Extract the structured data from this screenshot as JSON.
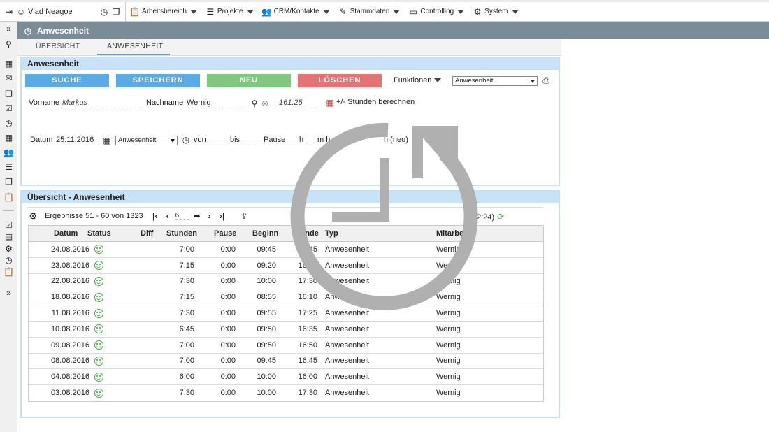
{
  "topbar": {
    "user": "Vlad Neagoe",
    "menus": [
      {
        "label": "Arbeitsbereich",
        "icon": "clipboard-icon"
      },
      {
        "label": "Projekte",
        "icon": "chart-icon"
      },
      {
        "label": "CRM/Kontakte",
        "icon": "contacts-icon"
      },
      {
        "label": "Stammdaten",
        "icon": "pen-icon"
      },
      {
        "label": "Controlling",
        "icon": "presentation-icon"
      },
      {
        "label": "System",
        "icon": "gear-icon"
      }
    ]
  },
  "header": {
    "title": "Anwesenheit"
  },
  "tabs": [
    {
      "label": "ÜBERSICHT"
    },
    {
      "label": "ANWESENHEIT"
    }
  ],
  "form_panel": {
    "title": "Anwesenheit",
    "buttons": {
      "search": "SUCHE",
      "save": "SPEICHERN",
      "new": "NEU",
      "delete": "LÖSCHEN"
    },
    "functions_label": "Funktionen",
    "type_select": "Anwesenheit",
    "vorname_label": "Vorname",
    "vorname_value": "Markus",
    "nachname_label": "Nachname",
    "nachname_value": "Wernig",
    "hours_value": "161:25",
    "calc_label": "+/- Stunden berechnen",
    "datum_label": "Datum",
    "datum_value": "25.11.2016",
    "entry_type": "Anwesenheit",
    "von_label": "von",
    "bis_label": "bis",
    "pause_label": "Pause",
    "h_label": "h",
    "mh_label": "m h =",
    "neu_label": "h (neu)"
  },
  "list_panel": {
    "title": "Übersicht - Anwesenheit",
    "results_label": "Ergebnisse 51 - 60 von 1323",
    "page_value": "6",
    "total_partial": "12:24)",
    "columns": [
      "Datum",
      "Status",
      "Diff",
      "Stunden",
      "Pause",
      "Beginn",
      "Ende",
      "Typ",
      "Mitarbeiter"
    ],
    "rows": [
      {
        "datum": "24.08.2016",
        "stunden": "7:00",
        "pause": "0:00",
        "beginn": "09:45",
        "ende": "16:45",
        "typ": "Anwesenheit",
        "mitarbeiter": "Wernig"
      },
      {
        "datum": "23.08.2016",
        "stunden": "7:15",
        "pause": "0:00",
        "beginn": "09:20",
        "ende": "16:35",
        "typ": "Anwesenheit",
        "mitarbeiter": "Wernig"
      },
      {
        "datum": "22.08.2016",
        "stunden": "7:30",
        "pause": "0:00",
        "beginn": "10:00",
        "ende": "17:30",
        "typ": "Anwesenheit",
        "mitarbeiter": "Wernig"
      },
      {
        "datum": "18.08.2016",
        "stunden": "7:15",
        "pause": "0:00",
        "beginn": "08:55",
        "ende": "16:10",
        "typ": "Anwesenheit",
        "mitarbeiter": "Wernig"
      },
      {
        "datum": "11.08.2016",
        "stunden": "7:30",
        "pause": "0:00",
        "beginn": "09:55",
        "ende": "17:25",
        "typ": "Anwesenheit",
        "mitarbeiter": "Wernig"
      },
      {
        "datum": "10.08.2016",
        "stunden": "6:45",
        "pause": "0:00",
        "beginn": "09:50",
        "ende": "16:35",
        "typ": "Anwesenheit",
        "mitarbeiter": "Wernig"
      },
      {
        "datum": "09.08.2016",
        "stunden": "7:00",
        "pause": "0:00",
        "beginn": "09:50",
        "ende": "16:50",
        "typ": "Anwesenheit",
        "mitarbeiter": "Wernig"
      },
      {
        "datum": "08.08.2016",
        "stunden": "7:00",
        "pause": "0:00",
        "beginn": "09:45",
        "ende": "16:45",
        "typ": "Anwesenheit",
        "mitarbeiter": "Wernig"
      },
      {
        "datum": "04.08.2016",
        "stunden": "6:00",
        "pause": "0:00",
        "beginn": "10:00",
        "ende": "16:00",
        "typ": "Anwesenheit",
        "mitarbeiter": "Wernig"
      },
      {
        "datum": "03.08.2016",
        "stunden": "7:30",
        "pause": "0:00",
        "beginn": "10:00",
        "ende": "17:30",
        "typ": "Anwesenheit",
        "mitarbeiter": "Wernig"
      }
    ]
  },
  "colors": {
    "header": "#7b8c99",
    "search": "#5aaae6",
    "save": "#5aaae6",
    "new": "#7fc97f",
    "delete": "#e57373",
    "panel_title": "#c8e2f7",
    "status_ok": "#3aaa3a",
    "overlay": "#b0b0b0"
  },
  "overlay": {
    "icon": "history-icon"
  }
}
